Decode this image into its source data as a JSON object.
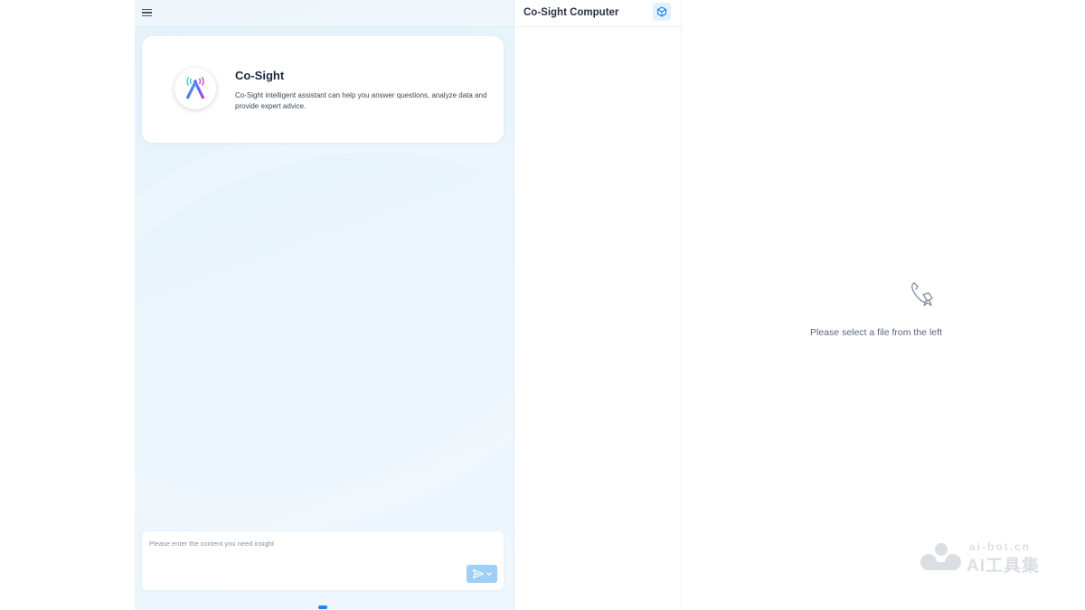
{
  "chat": {
    "menu_icon": "hamburger-menu-icon",
    "intro": {
      "logo_icon": "co-sight-logo-icon",
      "title": "Co-Sight",
      "description": "Co-Sight intelligent assistant can help you answer questions, analyze data and provide expert advice."
    },
    "input": {
      "placeholder": "Please enter the content you need insight",
      "value": "",
      "send_icon": "send-arrow-icon"
    }
  },
  "computer": {
    "title": "Co-Sight Computer",
    "toolbar_icon": "cube-icon"
  },
  "viewer": {
    "empty_icon": "document-pen-icon",
    "empty_text": "Please select a file from the left"
  },
  "watermark": {
    "domain": "ai-bot.cn",
    "brand": "AI工具集"
  },
  "colors": {
    "accent": "#1e86e6",
    "send_button": "#9fcff5",
    "chat_background": "#e8f4fc"
  }
}
